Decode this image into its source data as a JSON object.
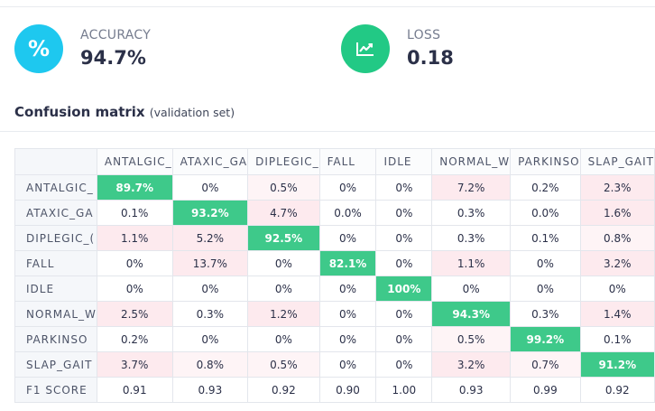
{
  "metrics": {
    "accuracy": {
      "label": "ACCURACY",
      "value": "94.7%",
      "icon": "percent-icon",
      "color": "#1ec8ef"
    },
    "loss": {
      "label": "LOSS",
      "value": "0.18",
      "icon": "trend-chart-icon",
      "color": "#22c985"
    }
  },
  "confusion_matrix": {
    "title": "Confusion matrix",
    "subtitle": "(validation set)",
    "columns": [
      "ANTALGIC_",
      "ATAXIC_GA",
      "DIPLEGIC_",
      "FALL",
      "IDLE",
      "NORMAL_W",
      "PARKINSO",
      "SLAP_GAIT"
    ],
    "rows": [
      {
        "label": "ANTALGIC_",
        "values": [
          "89.7%",
          "0%",
          "0.5%",
          "0%",
          "0%",
          "7.2%",
          "0.2%",
          "2.3%"
        ]
      },
      {
        "label": "ATAXIC_GA",
        "values": [
          "0.1%",
          "93.2%",
          "4.7%",
          "0.0%",
          "0%",
          "0.3%",
          "0.0%",
          "1.6%"
        ]
      },
      {
        "label": "DIPLEGIC_(",
        "values": [
          "1.1%",
          "5.2%",
          "92.5%",
          "0%",
          "0%",
          "0.3%",
          "0.1%",
          "0.8%"
        ]
      },
      {
        "label": "FALL",
        "values": [
          "0%",
          "13.7%",
          "0%",
          "82.1%",
          "0%",
          "1.1%",
          "0%",
          "3.2%"
        ]
      },
      {
        "label": "IDLE",
        "values": [
          "0%",
          "0%",
          "0%",
          "0%",
          "100%",
          "0%",
          "0%",
          "0%"
        ]
      },
      {
        "label": "NORMAL_W",
        "values": [
          "2.5%",
          "0.3%",
          "1.2%",
          "0%",
          "0%",
          "94.3%",
          "0.3%",
          "1.4%"
        ]
      },
      {
        "label": "PARKINSO",
        "values": [
          "0.2%",
          "0%",
          "0%",
          "0%",
          "0%",
          "0.5%",
          "99.2%",
          "0.1%"
        ]
      },
      {
        "label": "SLAP_GAIT",
        "values": [
          "3.7%",
          "0.8%",
          "0.5%",
          "0%",
          "0%",
          "3.2%",
          "0.7%",
          "91.2%"
        ]
      }
    ],
    "f1": {
      "label": "F1 SCORE",
      "values": [
        "0.91",
        "0.93",
        "0.92",
        "0.90",
        "1.00",
        "0.93",
        "0.99",
        "0.92"
      ]
    },
    "colors": {
      "diagonal": "#3ec98a",
      "error_tint": "#fdeaee",
      "header_bg": "#f5f7fa"
    }
  }
}
